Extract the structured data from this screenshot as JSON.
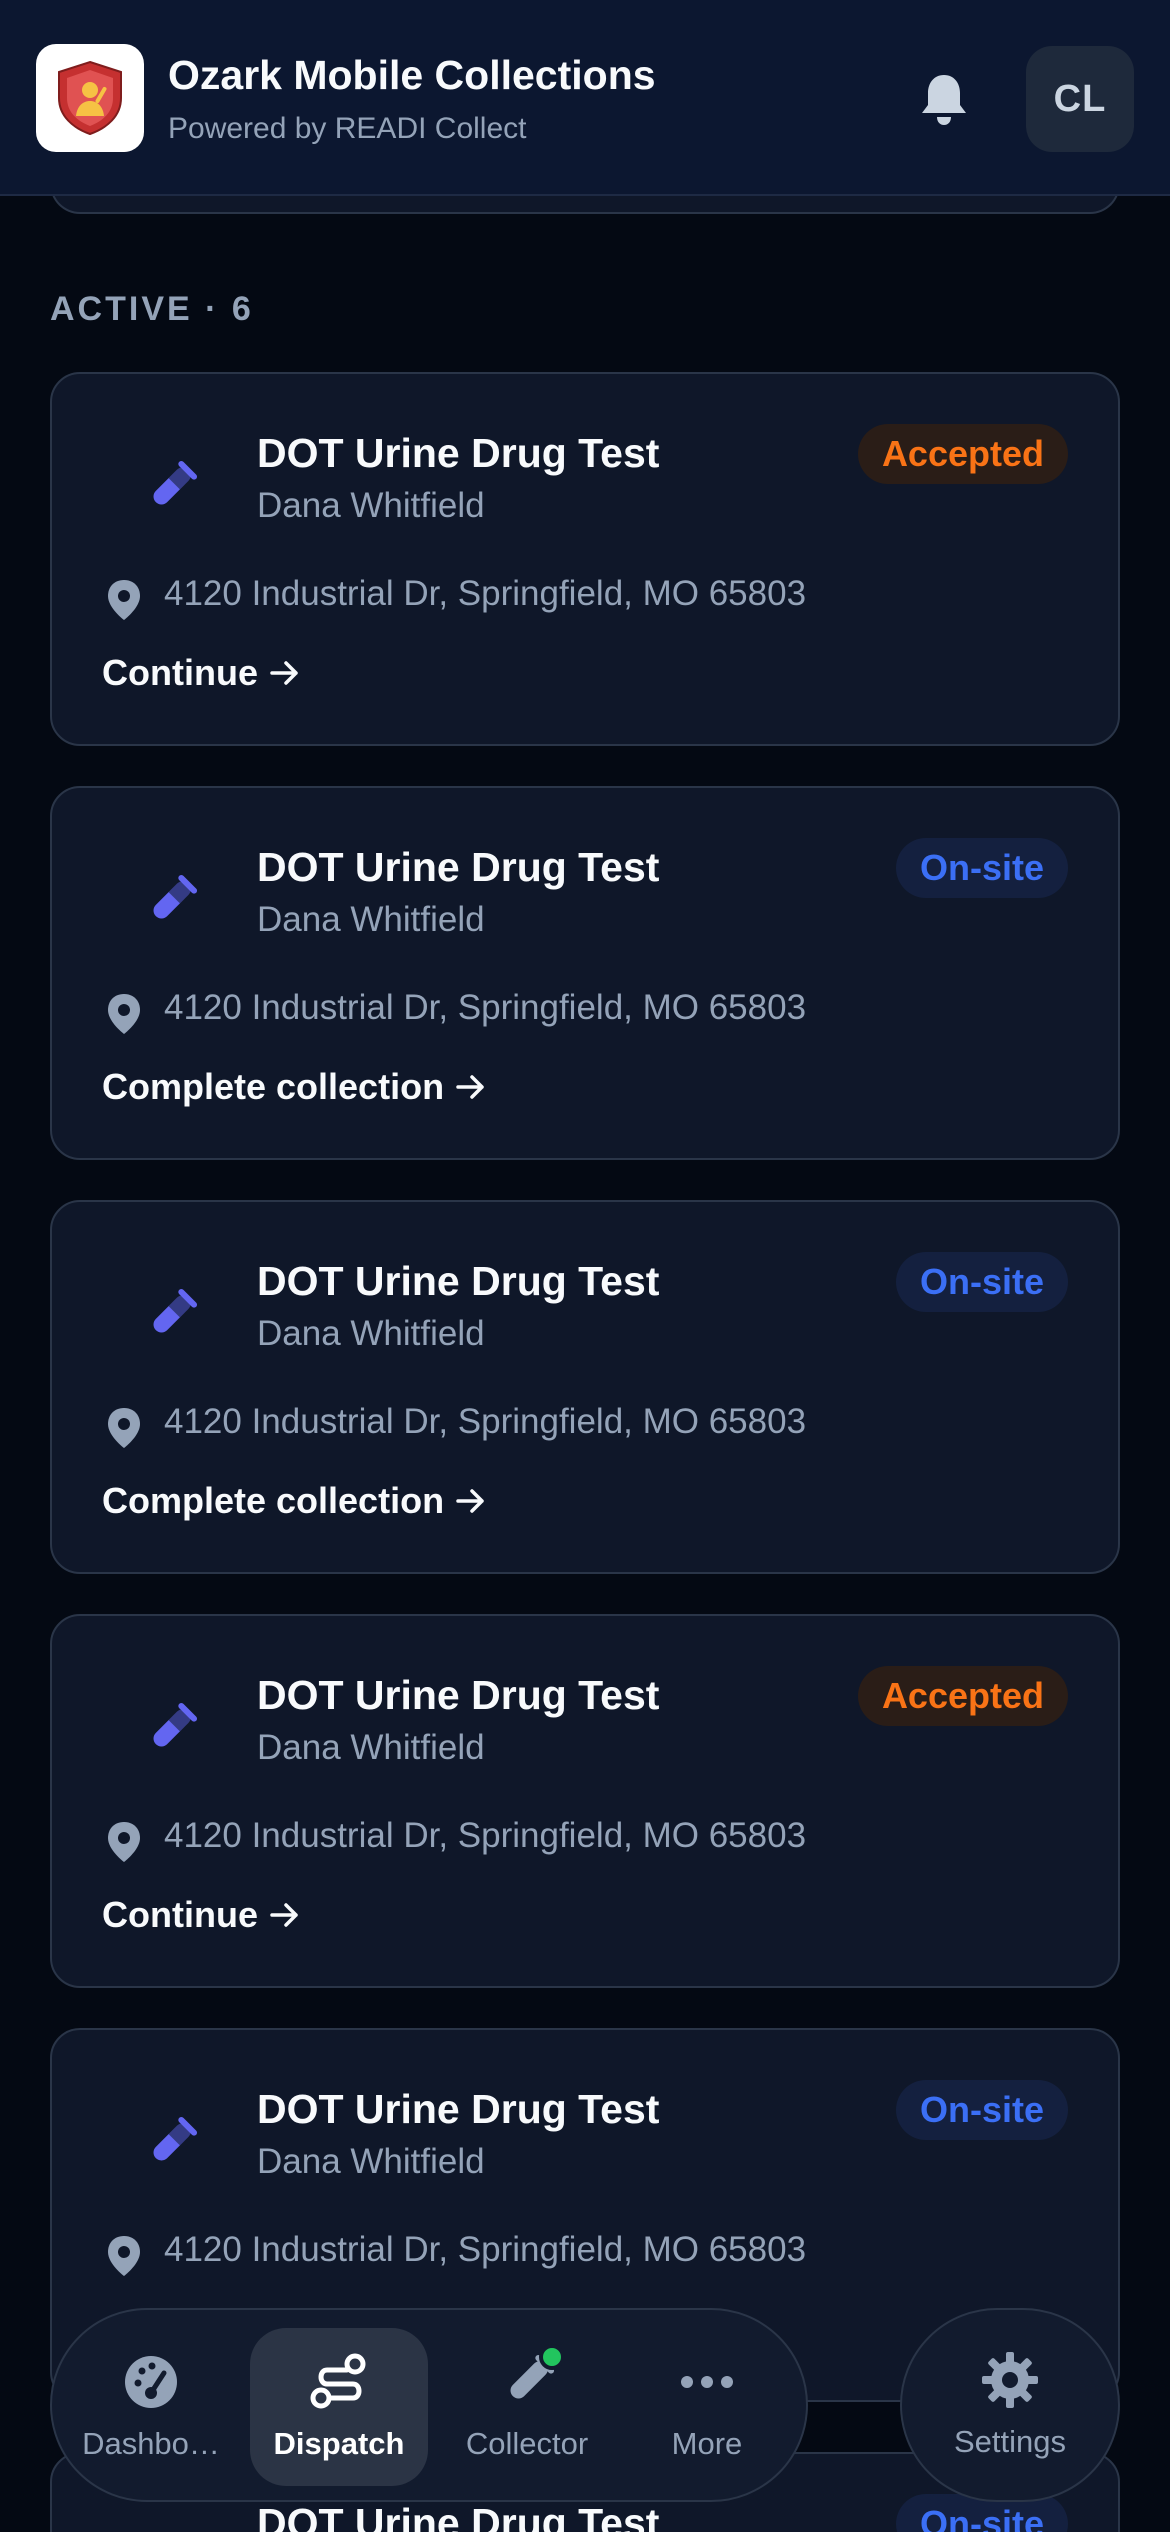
{
  "header": {
    "title": "Ozark Mobile Collections",
    "subtitle": "Powered by READI Collect",
    "avatar_initials": "CL"
  },
  "section": {
    "label": "ACTIVE · 6"
  },
  "colors": {
    "accepted": "#f97316",
    "onsite": "#3b6ff5",
    "icon_accent": "#6366f1",
    "online_dot": "#22c55e"
  },
  "cards": [
    {
      "title": "DOT Urine Drug Test",
      "person": "Dana Whitfield",
      "status": "Accepted",
      "address": "4120 Industrial Dr, Springfield, MO 65803",
      "action": "Continue"
    },
    {
      "title": "DOT Urine Drug Test",
      "person": "Dana Whitfield",
      "status": "On-site",
      "address": "4120 Industrial Dr, Springfield, MO 65803",
      "action": "Complete collection"
    },
    {
      "title": "DOT Urine Drug Test",
      "person": "Dana Whitfield",
      "status": "On-site",
      "address": "4120 Industrial Dr, Springfield, MO 65803",
      "action": "Complete collection"
    },
    {
      "title": "DOT Urine Drug Test",
      "person": "Dana Whitfield",
      "status": "Accepted",
      "address": "4120 Industrial Dr, Springfield, MO 65803",
      "action": "Continue"
    },
    {
      "title": "DOT Urine Drug Test",
      "person": "Dana Whitfield",
      "status": "On-site",
      "address": "4120 Industrial Dr, Springfield, MO 65803",
      "action": ""
    },
    {
      "title": "DOT Urine Drug Test",
      "person": "",
      "status": "On-site",
      "address": "",
      "action": ""
    }
  ],
  "tabbar": {
    "tabs": [
      {
        "label": "Dashbo…",
        "icon": "gauge-icon"
      },
      {
        "label": "Dispatch",
        "icon": "route-icon"
      },
      {
        "label": "Collector",
        "icon": "test-tube-icon"
      },
      {
        "label": "More",
        "icon": "more-dots-icon"
      }
    ],
    "settings_label": "Settings"
  }
}
